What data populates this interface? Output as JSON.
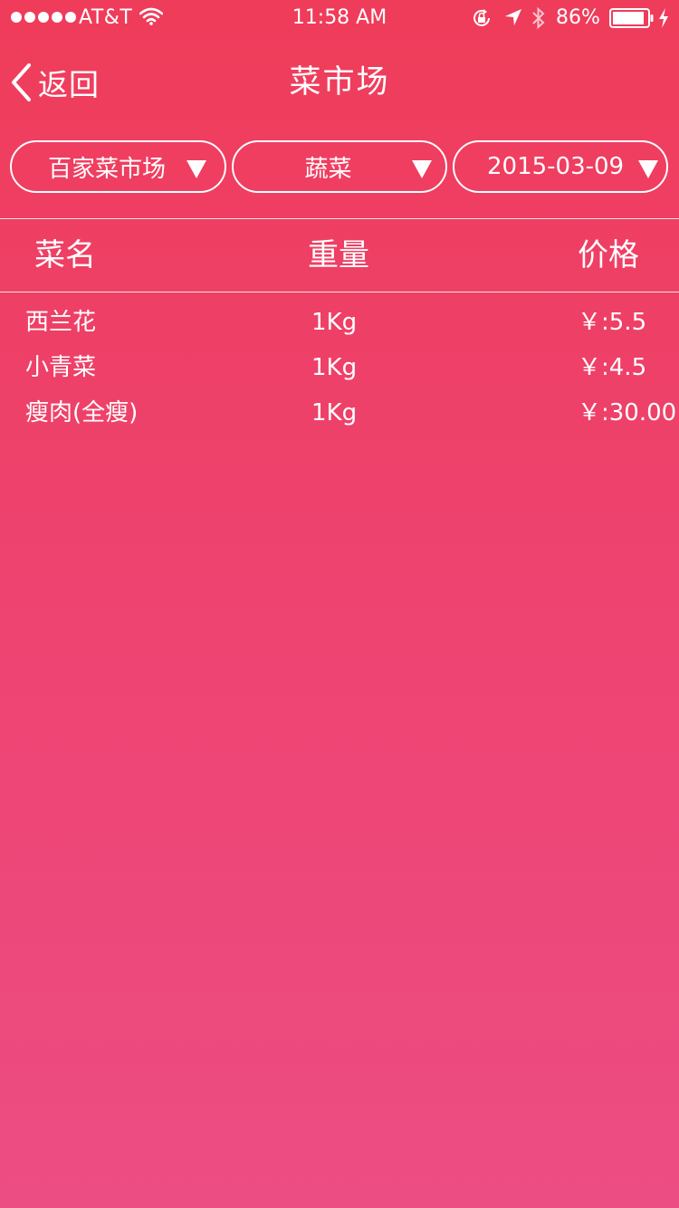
{
  "status_bar": {
    "carrier": "AT&T",
    "time": "11:58 AM",
    "battery": "86%",
    "signal_bars": 5,
    "battery_level": 0.86,
    "icons": [
      "wifi-icon",
      "orientation-lock-icon",
      "location-icon",
      "bluetooth-icon",
      "battery-icon",
      "charging-icon"
    ]
  },
  "nav": {
    "back_label": "返回",
    "title": "菜市场"
  },
  "filters": {
    "market": "百家菜市场",
    "category": "蔬菜",
    "date": "2015-03-09"
  },
  "table": {
    "headers": {
      "name": "菜名",
      "weight": "重量",
      "price": "价格"
    },
    "rows": [
      {
        "name": "西兰花",
        "weight": "1Kg",
        "price": "￥:5.5"
      },
      {
        "name": "小青菜",
        "weight": "1Kg",
        "price": "￥:4.5"
      },
      {
        "name": "瘦肉(全瘦)",
        "weight": "1Kg",
        "price": "￥:30.00"
      }
    ]
  },
  "colors": {
    "background_top": "#ef3c5a",
    "background_bottom": "#ec4d83",
    "foreground": "#ffffff"
  }
}
